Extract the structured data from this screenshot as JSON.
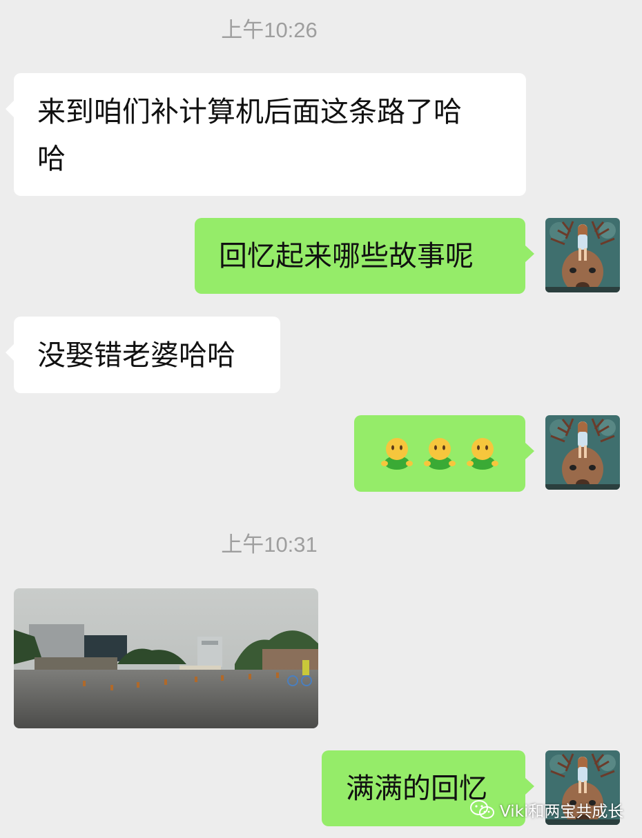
{
  "timestamps": [
    "上午10:26",
    "上午10:31"
  ],
  "messages": [
    {
      "side": "in",
      "line1": "来到咱们补计算机后面这条路了哈",
      "line2": "哈"
    },
    {
      "side": "out",
      "text": "回忆起来哪些故事呢"
    },
    {
      "side": "in",
      "text": "没娶错老婆哈哈"
    },
    {
      "side": "out",
      "emoji_count": 3
    },
    {
      "side": "in",
      "image": "road-photo"
    },
    {
      "side": "out",
      "text": "满满的回忆"
    }
  ],
  "watermark": {
    "text": "Viki和两宝共成长",
    "icon": "wechat-icon"
  },
  "colors": {
    "background": "#ededed",
    "incoming_bubble": "#ffffff",
    "outgoing_bubble": "#95ec69",
    "timestamp": "#9e9e9e"
  }
}
